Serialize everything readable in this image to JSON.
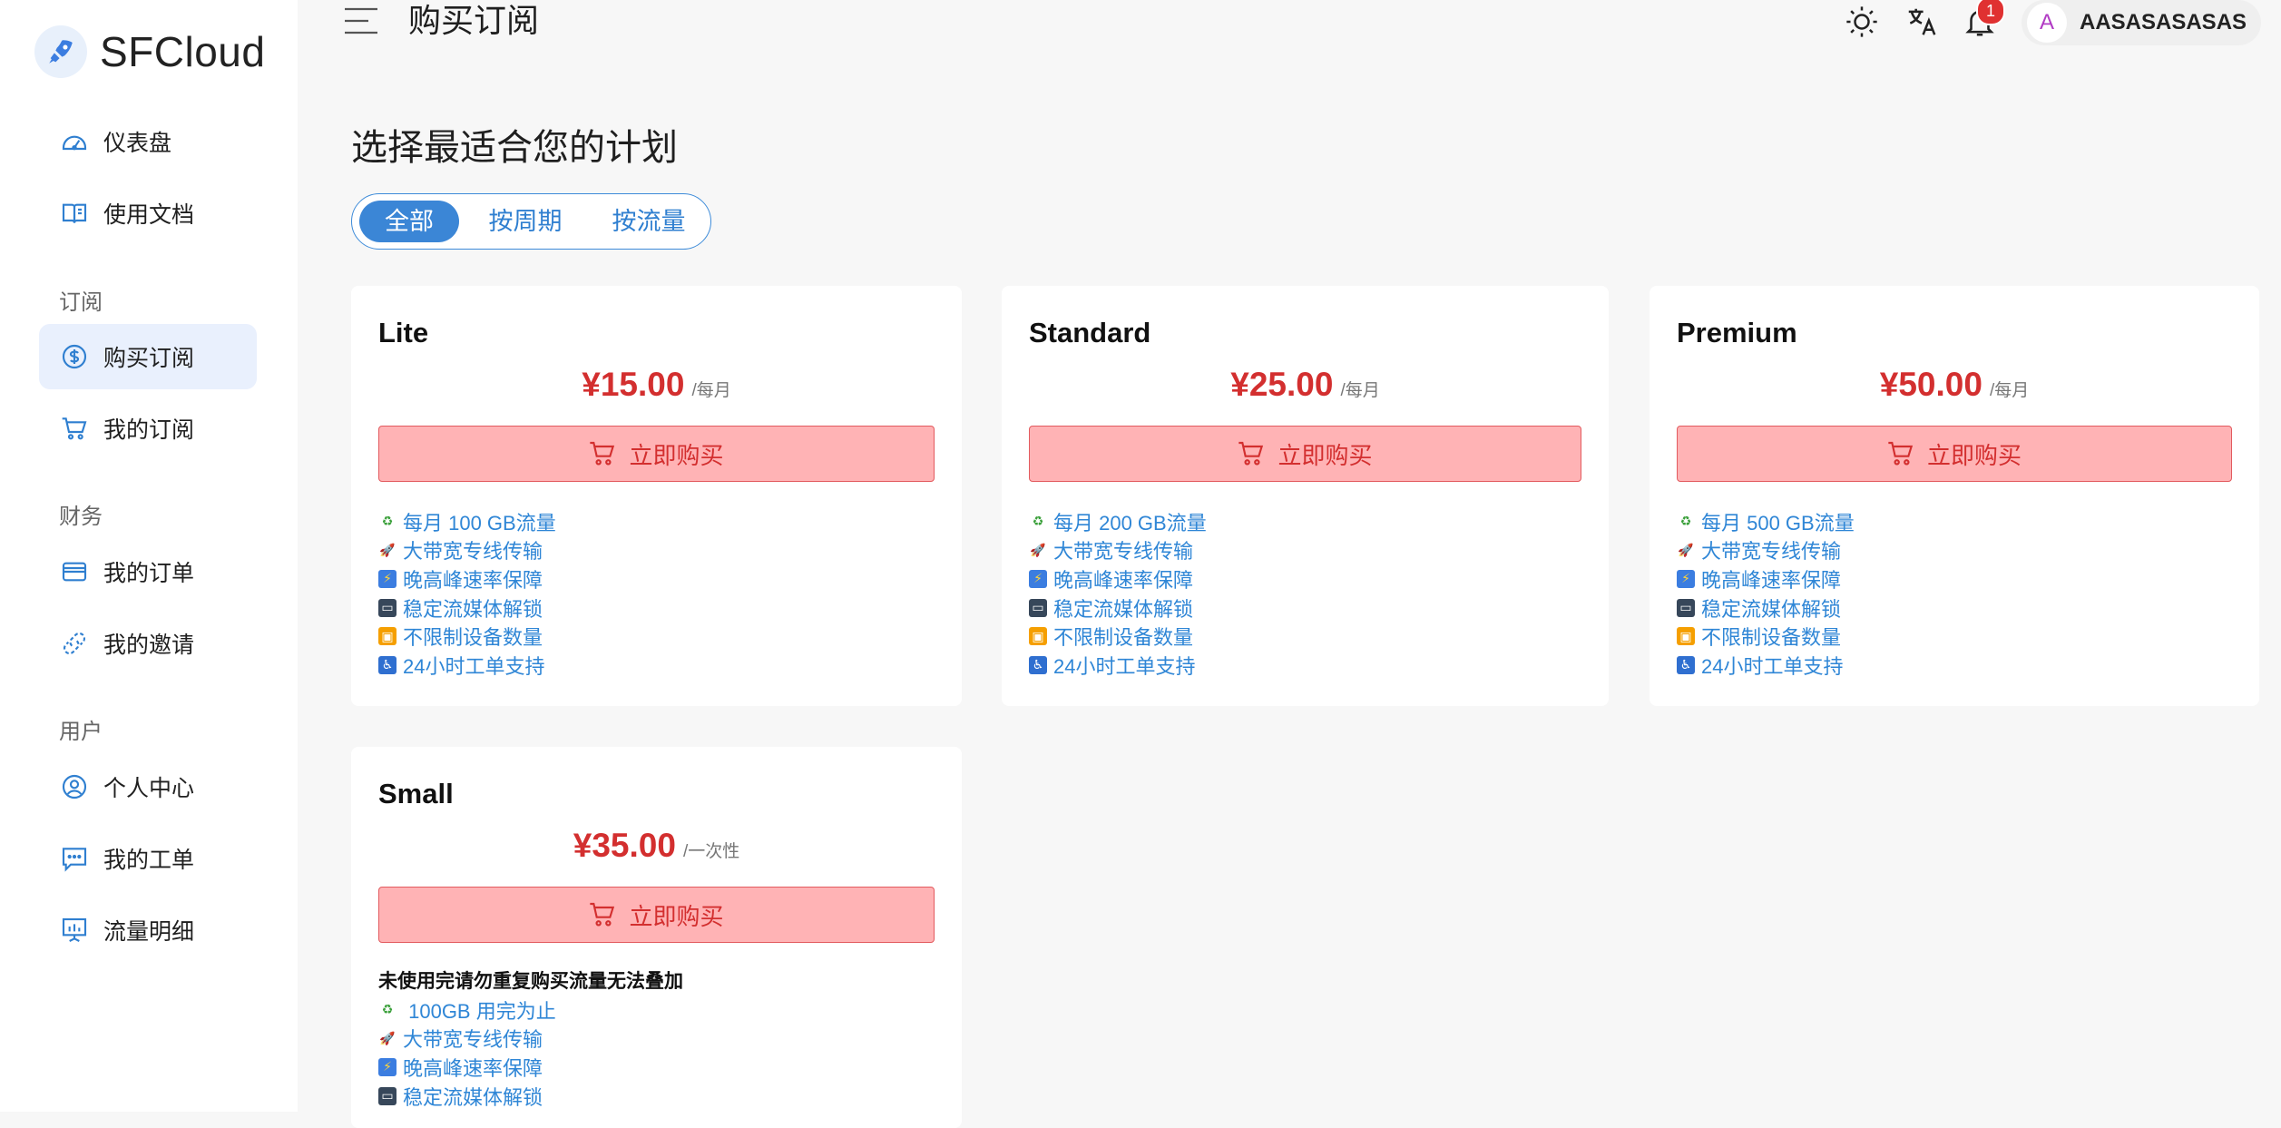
{
  "app": {
    "name": "SFCloud"
  },
  "header": {
    "title": "购买订阅",
    "notification_count": "1",
    "user_initial": "A",
    "user_name": "AASASASASAS"
  },
  "sidebar": {
    "items": [
      {
        "label": "仪表盘",
        "icon": "dashboard-gauge-icon"
      },
      {
        "label": "使用文档",
        "icon": "book-icon"
      }
    ],
    "sections": [
      {
        "title": "订阅",
        "items": [
          {
            "label": "购买订阅",
            "icon": "dollar-coin-icon",
            "active": true
          },
          {
            "label": "我的订阅",
            "icon": "cart-icon"
          }
        ]
      },
      {
        "title": "财务",
        "items": [
          {
            "label": "我的订单",
            "icon": "wallet-card-icon"
          },
          {
            "label": "我的邀请",
            "icon": "link-share-icon"
          }
        ]
      },
      {
        "title": "用户",
        "items": [
          {
            "label": "个人中心",
            "icon": "user-circle-icon"
          },
          {
            "label": "我的工单",
            "icon": "chat-ticket-icon"
          },
          {
            "label": "流量明细",
            "icon": "chart-board-icon"
          }
        ]
      }
    ]
  },
  "main": {
    "heading": "选择最适合您的计划",
    "filter_tabs": [
      {
        "label": "全部",
        "active": true
      },
      {
        "label": "按周期"
      },
      {
        "label": "按流量"
      }
    ],
    "plans": [
      {
        "name": "Lite",
        "price": "¥15.00",
        "period": "/每月",
        "buy_label": "立即购买",
        "features": [
          "每月 100 GB流量",
          "大带宽专线传输",
          "晚高峰速率保障",
          "稳定流媒体解锁",
          "不限制设备数量",
          "24小时工单支持"
        ]
      },
      {
        "name": "Standard",
        "price": "¥25.00",
        "period": "/每月",
        "buy_label": "立即购买",
        "features": [
          "每月 200 GB流量",
          "大带宽专线传输",
          "晚高峰速率保障",
          "稳定流媒体解锁",
          "不限制设备数量",
          "24小时工单支持"
        ]
      },
      {
        "name": "Premium",
        "price": "¥50.00",
        "period": "/每月",
        "buy_label": "立即购买",
        "features": [
          "每月 500 GB流量",
          "大带宽专线传输",
          "晚高峰速率保障",
          "稳定流媒体解锁",
          "不限制设备数量",
          "24小时工单支持"
        ]
      },
      {
        "name": "Small",
        "price": "¥35.00",
        "period": "/一次性",
        "buy_label": "立即购买",
        "notice": "未使用完请勿重复购买流量无法叠加",
        "features": [
          " 100GB 用完为止",
          "大带宽专线传输",
          "晚高峰速率保障",
          "稳定流媒体解锁"
        ]
      }
    ],
    "feature_emojis": [
      "recycle-icon",
      "rocket-icon",
      "lightning-icon",
      "tv-icon",
      "grid-icon",
      "wheelchair-icon"
    ]
  },
  "colors": {
    "accent": "#3b86d6",
    "price": "#d32f2f",
    "buy_bg": "#ffb3b5",
    "feature_text": "#2f86d6",
    "badge": "#e03131"
  }
}
